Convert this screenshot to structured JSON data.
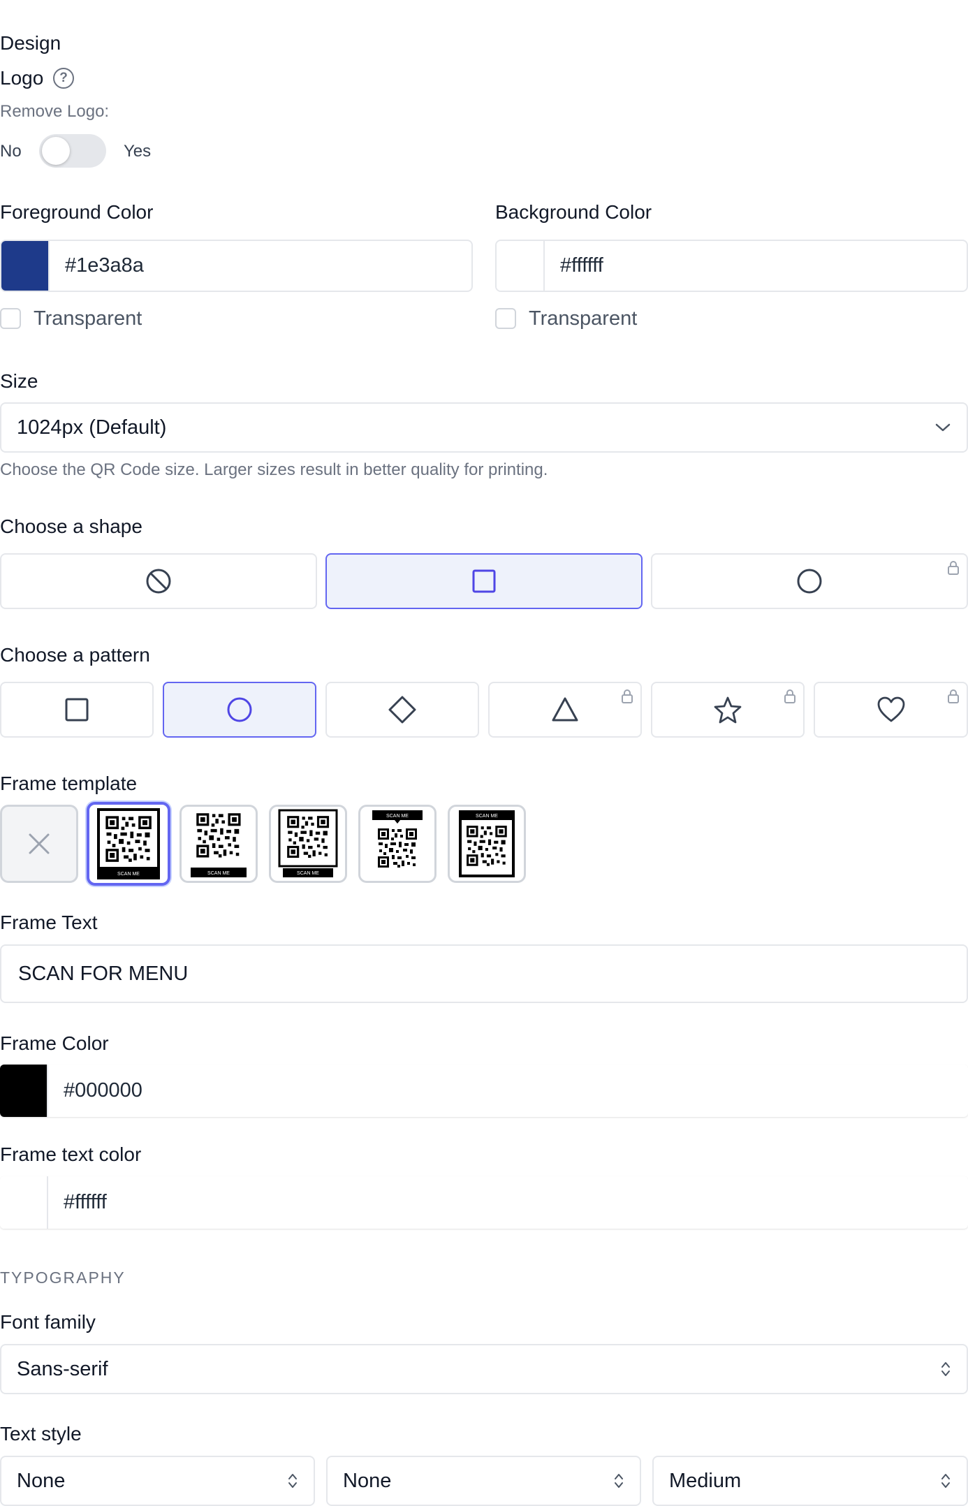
{
  "design": {
    "section_title": "Design",
    "logo": {
      "label": "Logo",
      "help_icon": "question-circle-icon",
      "remove_logo_label": "Remove Logo:",
      "toggle_off_label": "No",
      "toggle_on_label": "Yes",
      "toggle_state": "off"
    },
    "foreground": {
      "label": "Foreground Color",
      "value": "#1e3a8a",
      "swatch": "#1e3a8a",
      "transparent_label": "Transparent",
      "transparent_checked": false
    },
    "background": {
      "label": "Background Color",
      "value": "#ffffff",
      "swatch": "#ffffff",
      "transparent_label": "Transparent",
      "transparent_checked": false
    },
    "size": {
      "label": "Size",
      "value": "1024px (Default)",
      "help": "Choose the QR Code size. Larger sizes result in better quality for printing."
    },
    "shape": {
      "label": "Choose a shape",
      "options": [
        {
          "icon": "none-icon",
          "selected": false,
          "locked": false
        },
        {
          "icon": "square-icon",
          "selected": true,
          "locked": false
        },
        {
          "icon": "circle-icon",
          "selected": false,
          "locked": true
        }
      ]
    },
    "pattern": {
      "label": "Choose a pattern",
      "options": [
        {
          "icon": "square-icon",
          "selected": false,
          "locked": false
        },
        {
          "icon": "circle-icon",
          "selected": true,
          "locked": false
        },
        {
          "icon": "diamond-icon",
          "selected": false,
          "locked": false
        },
        {
          "icon": "triangle-icon",
          "selected": false,
          "locked": true
        },
        {
          "icon": "star-icon",
          "selected": false,
          "locked": true
        },
        {
          "icon": "heart-icon",
          "selected": false,
          "locked": true
        }
      ]
    },
    "frame_template": {
      "label": "Frame template",
      "scan_me": "SCAN ME",
      "options": [
        {
          "style": "none",
          "selected": false
        },
        {
          "style": "bottom-bar-boxed",
          "selected": true
        },
        {
          "style": "bottom-bar",
          "selected": false
        },
        {
          "style": "bottom-bar-bordered",
          "selected": false
        },
        {
          "style": "top-bubble",
          "selected": false
        },
        {
          "style": "top-bar-bordered",
          "selected": false
        }
      ]
    },
    "frame_text": {
      "label": "Frame Text",
      "value": "SCAN FOR MENU"
    },
    "frame_color": {
      "label": "Frame Color",
      "value": "#000000",
      "swatch": "#000000"
    },
    "frame_text_color": {
      "label": "Frame text color",
      "value": "#ffffff",
      "swatch": "#ffffff"
    }
  },
  "typography": {
    "section_title": "TYPOGRAPHY",
    "font_family": {
      "label": "Font family",
      "value": "Sans-serif"
    },
    "text_style": {
      "label": "Text style",
      "values": [
        "None",
        "None",
        "Medium"
      ]
    }
  }
}
